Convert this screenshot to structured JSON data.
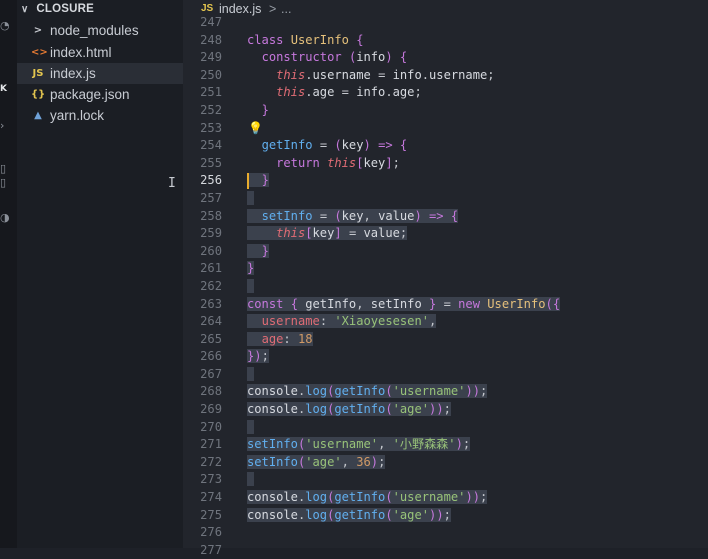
{
  "explorer": {
    "folder": "CLOSURE",
    "items": [
      {
        "label": "node_modules",
        "icon": ">",
        "icon_color": "#c5c8ce",
        "indent": 0
      },
      {
        "label": "index.html",
        "icon": "<>",
        "icon_color": "#e37933",
        "indent": 0
      },
      {
        "label": "index.js",
        "icon": "JS",
        "icon_color": "#e4c64f",
        "indent": 0
      },
      {
        "label": "package.json",
        "icon": "{}",
        "icon_color": "#e4c64f",
        "indent": 0
      },
      {
        "label": "yarn.lock",
        "icon": "▲",
        "icon_color": "#6fa2d8",
        "indent": 0
      }
    ]
  },
  "breadcrumb": {
    "badge": "JS",
    "file": "index.js",
    "sep": ">",
    "more": "..."
  },
  "lines": [
    {
      "num": "247",
      "code": ""
    },
    {
      "num": "248",
      "code": "class UserInfo {"
    },
    {
      "num": "249",
      "code": "  constructor (info) {"
    },
    {
      "num": "250",
      "code": "    this.username = info.username;"
    },
    {
      "num": "251",
      "code": "    this.age = info.age;"
    },
    {
      "num": "252",
      "code": "  }"
    },
    {
      "num": "253",
      "code": ""
    },
    {
      "num": "254",
      "code": "  getInfo = (key) => {"
    },
    {
      "num": "255",
      "code": "    return this[key];"
    },
    {
      "num": "256",
      "code": "  }"
    },
    {
      "num": "257",
      "code": ""
    },
    {
      "num": "258",
      "code": "  setInfo = (key, value) => {"
    },
    {
      "num": "259",
      "code": "    this[key] = value;"
    },
    {
      "num": "260",
      "code": "  }"
    },
    {
      "num": "261",
      "code": "}"
    },
    {
      "num": "262",
      "code": ""
    },
    {
      "num": "263",
      "code": "const { getInfo, setInfo } = new UserInfo({"
    },
    {
      "num": "264",
      "code": "  username: 'Xiaoyesesen',"
    },
    {
      "num": "265",
      "code": "  age: 18"
    },
    {
      "num": "266",
      "code": "});"
    },
    {
      "num": "267",
      "code": ""
    },
    {
      "num": "268",
      "code": "console.log(getInfo('username'));"
    },
    {
      "num": "269",
      "code": "console.log(getInfo('age'));"
    },
    {
      "num": "270",
      "code": ""
    },
    {
      "num": "271",
      "code": "setInfo('username', '小野森森');"
    },
    {
      "num": "272",
      "code": "setInfo('age', 36);"
    },
    {
      "num": "273",
      "code": ""
    },
    {
      "num": "274",
      "code": "console.log(getInfo('username'));"
    },
    {
      "num": "275",
      "code": "console.log(getInfo('age'));"
    },
    {
      "num": "276",
      "code": ""
    },
    {
      "num": "277",
      "code": ""
    }
  ],
  "current_line": "256",
  "lightbulb_line": "253",
  "colors": {
    "editor_bg": "#22252c",
    "sidebar_bg": "#1b1e24",
    "selection": "#3b414d",
    "keyword": "#c678dd",
    "class_name": "#e5c07b",
    "function": "#61afef",
    "string": "#98c379",
    "number": "#d19a66",
    "property": "#e06c75"
  }
}
